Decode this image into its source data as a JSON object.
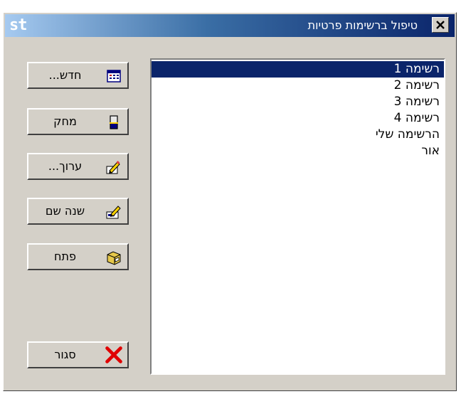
{
  "window": {
    "app_logo": "st",
    "title": "טיפול ברשימות פרטיות",
    "accent_color": "#0a246a"
  },
  "list": {
    "items": [
      {
        "label": "רשימה 1",
        "selected": true
      },
      {
        "label": "רשימה 2",
        "selected": false
      },
      {
        "label": "רשימה 3",
        "selected": false
      },
      {
        "label": "רשימה 4",
        "selected": false
      },
      {
        "label": "הרשימה שלי",
        "selected": false
      },
      {
        "label": "אור",
        "selected": false
      }
    ]
  },
  "buttons": {
    "new": {
      "label": "חדש...",
      "icon": "calendar-icon"
    },
    "delete": {
      "label": "מחק",
      "icon": "eraser-icon"
    },
    "edit": {
      "label": "ערוך...",
      "icon": "pencil-edit-icon"
    },
    "rename": {
      "label": "שנה שם",
      "icon": "rename-icon"
    },
    "open": {
      "label": "פתח",
      "icon": "open-folder-icon"
    },
    "close": {
      "label": "סגור",
      "icon": "red-x-icon"
    }
  }
}
